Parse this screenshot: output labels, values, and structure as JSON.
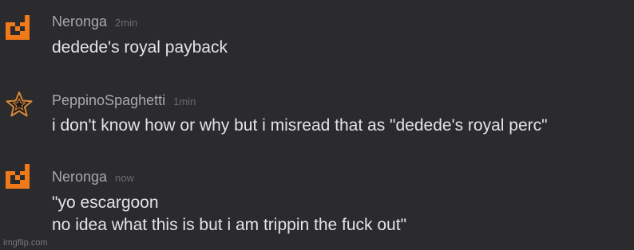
{
  "messages": [
    {
      "username": "Neronga",
      "timestamp": "2min",
      "lines": [
        "dedede's royal payback"
      ],
      "avatar_icon": "orange-pixel-creature-icon"
    },
    {
      "username": "PeppinoSpaghetti",
      "timestamp": "1min",
      "lines": [
        "i don't know how or why but i misread that as \"dedede's royal perc\""
      ],
      "avatar_icon": "star-badge-icon"
    },
    {
      "username": "Neronga",
      "timestamp": "now",
      "lines": [
        "\"yo escargoon",
        "no idea what this is but i am trippin the fuck out\""
      ],
      "avatar_icon": "orange-pixel-creature-icon"
    }
  ],
  "watermark": "imgflip.com",
  "colors": {
    "background": "#2b2b2d",
    "username": "#a9a9ad",
    "timestamp": "#6b6b70",
    "text": "#e4e4e6",
    "avatar_orange": "#f07a1a"
  }
}
